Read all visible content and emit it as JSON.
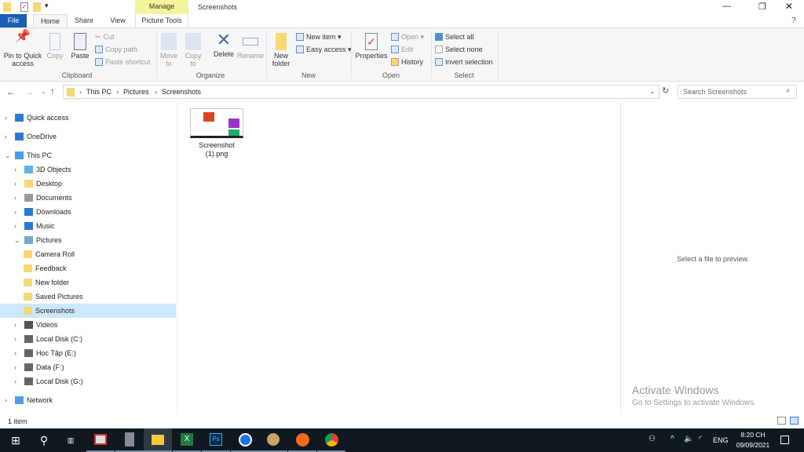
{
  "window": {
    "title": "Screenshots",
    "context_tab": "Manage",
    "controls": [
      "—",
      "❐",
      "✕"
    ]
  },
  "tabs": {
    "file": "File",
    "home": "Home",
    "share": "Share",
    "view": "View",
    "picture_tools": "Picture Tools"
  },
  "ribbon": {
    "clipboard": {
      "label": "Clipboard",
      "pin": "Pin to Quick access",
      "copy": "Copy",
      "paste": "Paste",
      "cut": "Cut",
      "copy_path": "Copy path",
      "paste_shortcut": "Paste shortcut"
    },
    "organize": {
      "label": "Organize",
      "move_to": "Move to",
      "copy_to": "Copy to",
      "delete": "Delete",
      "rename": "Rename"
    },
    "new": {
      "label": "New",
      "new_folder": "New folder",
      "new_item": "New item ▾",
      "easy_access": "Easy access ▾"
    },
    "open": {
      "label": "Open",
      "properties": "Properties",
      "open": "Open ▾",
      "edit": "Edit",
      "history": "History"
    },
    "select": {
      "label": "Select",
      "select_all": "Select all",
      "select_none": "Select none",
      "invert": "Invert selection"
    }
  },
  "address": {
    "breadcrumb": [
      "This PC",
      "Pictures",
      "Screenshots"
    ],
    "search_placeholder": "Search Screenshots"
  },
  "nav": [
    {
      "label": "Quick access",
      "level": 0,
      "icon": "star-icon",
      "expanded": false
    },
    {
      "label": "OneDrive",
      "level": 0,
      "icon": "cloud-icon",
      "expanded": false
    },
    {
      "label": "This PC",
      "level": 0,
      "icon": "computer-icon",
      "expanded": true
    },
    {
      "label": "3D Objects",
      "level": 1,
      "icon": "cube-icon",
      "expanded": false
    },
    {
      "label": "Desktop",
      "level": 1,
      "icon": "folder-icon",
      "expanded": false
    },
    {
      "label": "Documents",
      "level": 1,
      "icon": "document-icon",
      "expanded": false
    },
    {
      "label": "Downloads",
      "level": 1,
      "icon": "download-icon",
      "expanded": false
    },
    {
      "label": "Music",
      "level": 1,
      "icon": "music-icon",
      "expanded": false
    },
    {
      "label": "Pictures",
      "level": 1,
      "icon": "pictures-icon",
      "expanded": true
    },
    {
      "label": "Camera Roll",
      "level": 2,
      "icon": "folder-icon"
    },
    {
      "label": "Feedback",
      "level": 2,
      "icon": "folder-icon"
    },
    {
      "label": "New folder",
      "level": 2,
      "icon": "folder-icon"
    },
    {
      "label": "Saved Pictures",
      "level": 2,
      "icon": "folder-icon"
    },
    {
      "label": "Screenshots",
      "level": 2,
      "icon": "folder-icon",
      "selected": true
    },
    {
      "label": "Videos",
      "level": 1,
      "icon": "video-icon",
      "expanded": false
    },
    {
      "label": "Local Disk (C:)",
      "level": 1,
      "icon": "drive-icon",
      "expanded": false
    },
    {
      "label": "Học Tập (E:)",
      "level": 1,
      "icon": "drive-icon",
      "expanded": false
    },
    {
      "label": "Data (F:)",
      "level": 1,
      "icon": "drive-icon",
      "expanded": false
    },
    {
      "label": "Local Disk (G:)",
      "level": 1,
      "icon": "drive-icon",
      "expanded": false
    },
    {
      "label": "Network",
      "level": 0,
      "icon": "network-icon",
      "expanded": false
    }
  ],
  "files": [
    {
      "name": "Screenshot (1).png"
    }
  ],
  "preview": {
    "message": "Select a file to preview."
  },
  "watermark": {
    "title": "Activate Windows",
    "subtitle": "Go to Settings to activate Windows."
  },
  "status": {
    "count": "1 item"
  },
  "taskbar": {
    "time": "8:20 CH",
    "date": "09/09/2021",
    "lang": "ENG"
  }
}
